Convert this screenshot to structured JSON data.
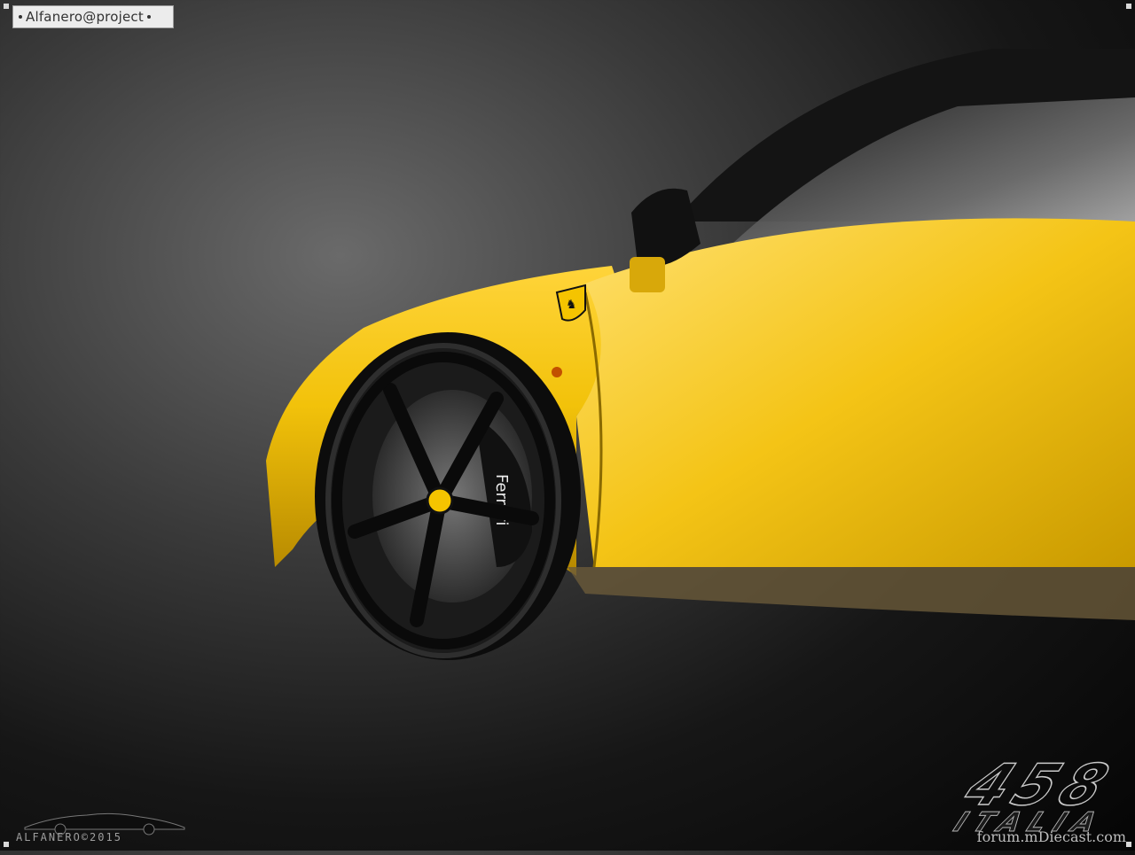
{
  "watermark": {
    "tag": "Alfanero@project",
    "brand": "ALFANERO©2015"
  },
  "title": {
    "model_number": "458",
    "model_name": "ITALIA"
  },
  "credit": {
    "site": "forum.mDiecast.com"
  },
  "wheel": {
    "caliper_text": "Ferrari"
  },
  "colors": {
    "body": "#f2c20a",
    "body_shadow": "#b58800",
    "background_dark": "#050505",
    "background_light": "#6a6a6a"
  }
}
